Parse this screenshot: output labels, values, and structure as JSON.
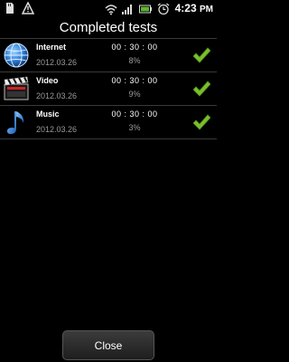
{
  "status_bar": {
    "time": "4:23",
    "time_suffix": "PM",
    "icons": [
      "sd-card-icon",
      "warning-icon",
      "wifi-icon",
      "signal-icon",
      "battery-icon",
      "alarm-clock-icon"
    ]
  },
  "title": "Completed tests",
  "tests": [
    {
      "name": "Internet",
      "date": "2012.03.26",
      "duration": "00 : 30 : 00",
      "progress": "8%",
      "icon": "globe-icon",
      "status": "completed"
    },
    {
      "name": "Video",
      "date": "2012.03.26",
      "duration": "00 : 30 : 00",
      "progress": "9%",
      "icon": "clapperboard-icon",
      "status": "completed"
    },
    {
      "name": "Music",
      "date": "2012.03.26",
      "duration": "00 : 30 : 00",
      "progress": "3%",
      "icon": "music-note-icon",
      "status": "completed"
    }
  ],
  "close_label": "Close",
  "colors": {
    "background": "#000000",
    "check": "#7bbf2c",
    "secondary_text": "#9a9a9a"
  }
}
